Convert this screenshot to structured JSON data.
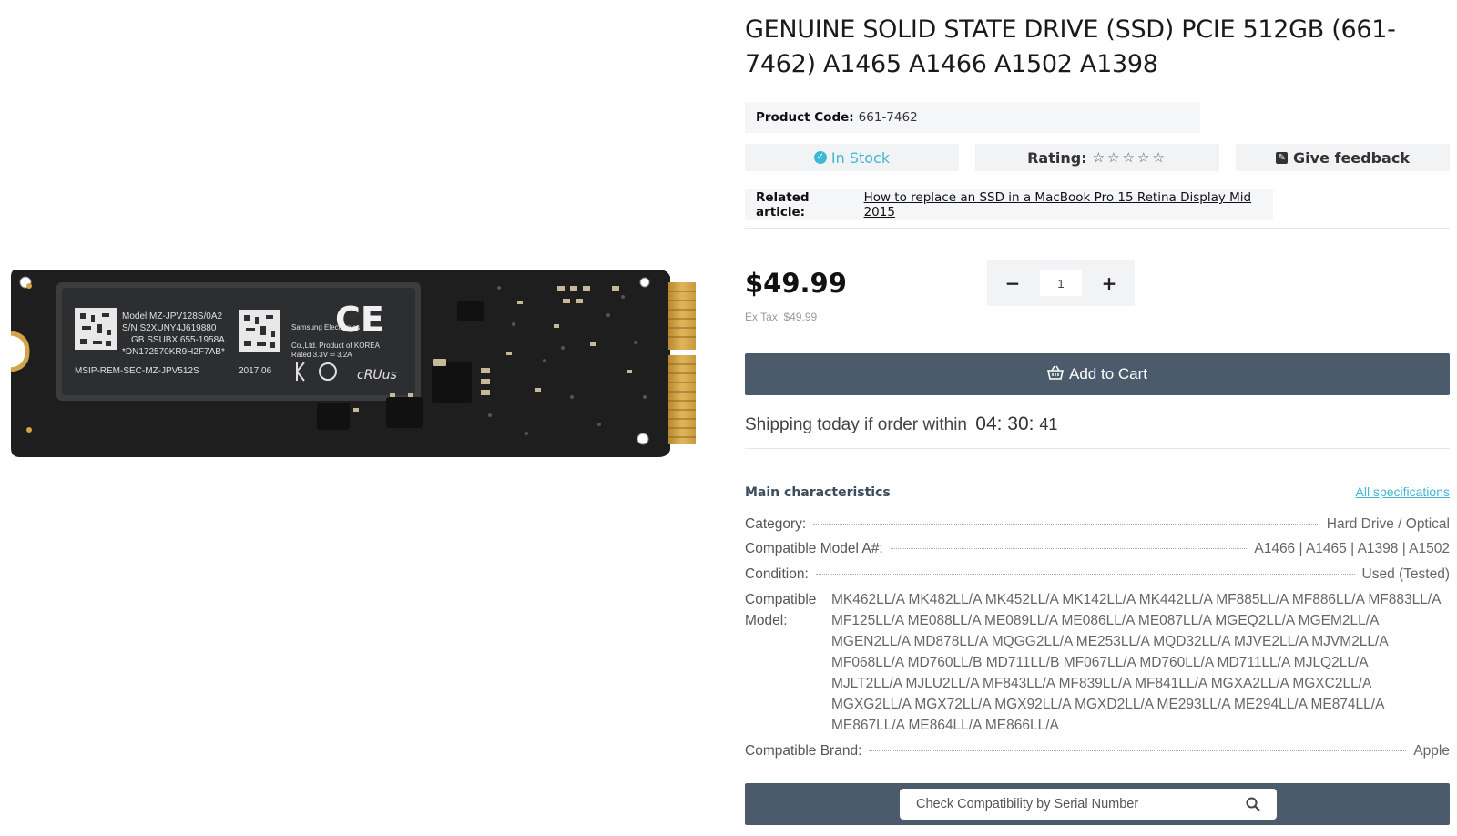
{
  "product": {
    "title": "GENUINE SOLID STATE DRIVE (SSD) PCIE 512GB (661-7462) A1465 A1466 A1502 A1398",
    "image_label_lines": {
      "model": "Model  MZ-JPV128S/0A2",
      "sn": "S/N  S2XUNY4J619880",
      "gb": "GB SSUBX   655-1958A",
      "dn": "*DN172570KR9H2F7AB*",
      "msip": "MSIP-REM-SEC-MZ-JPV512S",
      "date": "2017.06",
      "maker": "Samsung Electronics",
      "origin": "Co.,Ltd.  Product of KOREA",
      "rated": "Rated 3.3V ═ 3.2A"
    },
    "code_label": "Product Code:",
    "code_value": "661-7462",
    "stock_text": "In Stock",
    "rating_label": "Rating:",
    "rating_value": 0,
    "rating_max": 5,
    "feedback_label": "Give feedback",
    "related_label": "Related article:",
    "related_link": "How to replace an SSD in a MacBook Pro 15 Retina Display Mid 2015"
  },
  "pricing": {
    "price": "$49.99",
    "ex_tax": "Ex Tax: $49.99",
    "qty_minus": "−",
    "qty_value": "1",
    "qty_plus": "+",
    "add_to_cart": "Add to Cart"
  },
  "shipping": {
    "text": "Shipping today if order within",
    "hours": "04",
    "minutes": "30",
    "seconds": "41"
  },
  "characteristics": {
    "title": "Main characteristics",
    "all_specs": "All specifications",
    "category_label": "Category:",
    "category_value": "Hard Drive / Optical",
    "model_num_label": "Compatible Model A#:",
    "model_num_value": "A1466 | A1465 | A1398 | A1502",
    "condition_label": "Condition:",
    "condition_value": "Used (Tested)",
    "compat_model_label": "Compatible Model:",
    "compat_model_value": "MK462LL/A MK482LL/A MK452LL/A MK142LL/A MK442LL/A MF885LL/A MF886LL/A MF883LL/A MF125LL/A ME088LL/A ME089LL/A ME086LL/A ME087LL/A MGEQ2LL/A MGEM2LL/A MGEN2LL/A MD878LL/A MQGG2LL/A ME253LL/A MQD32LL/A MJVE2LL/A MJVM2LL/A MF068LL/A MD760LL/B MD711LL/B MF067LL/A MD760LL/A MD711LL/A MJLQ2LL/A MJLT2LL/A MJLU2LL/A MF843LL/A MF839LL/A MF841LL/A MGXA2LL/A MGXC2LL/A MGXG2LL/A MGX72LL/A MGX92LL/A MGXD2LL/A ME293LL/A ME294LL/A ME874LL/A ME867LL/A ME864LL/A ME866LL/A",
    "brand_label": "Compatible Brand:",
    "brand_value": "Apple"
  },
  "serial_check": {
    "placeholder": "Check Compatibility by Serial Number"
  },
  "colors": {
    "accent": "#3fb8d3",
    "button_bg": "#4b5b6b",
    "pill_bg": "#f2f3f4"
  }
}
